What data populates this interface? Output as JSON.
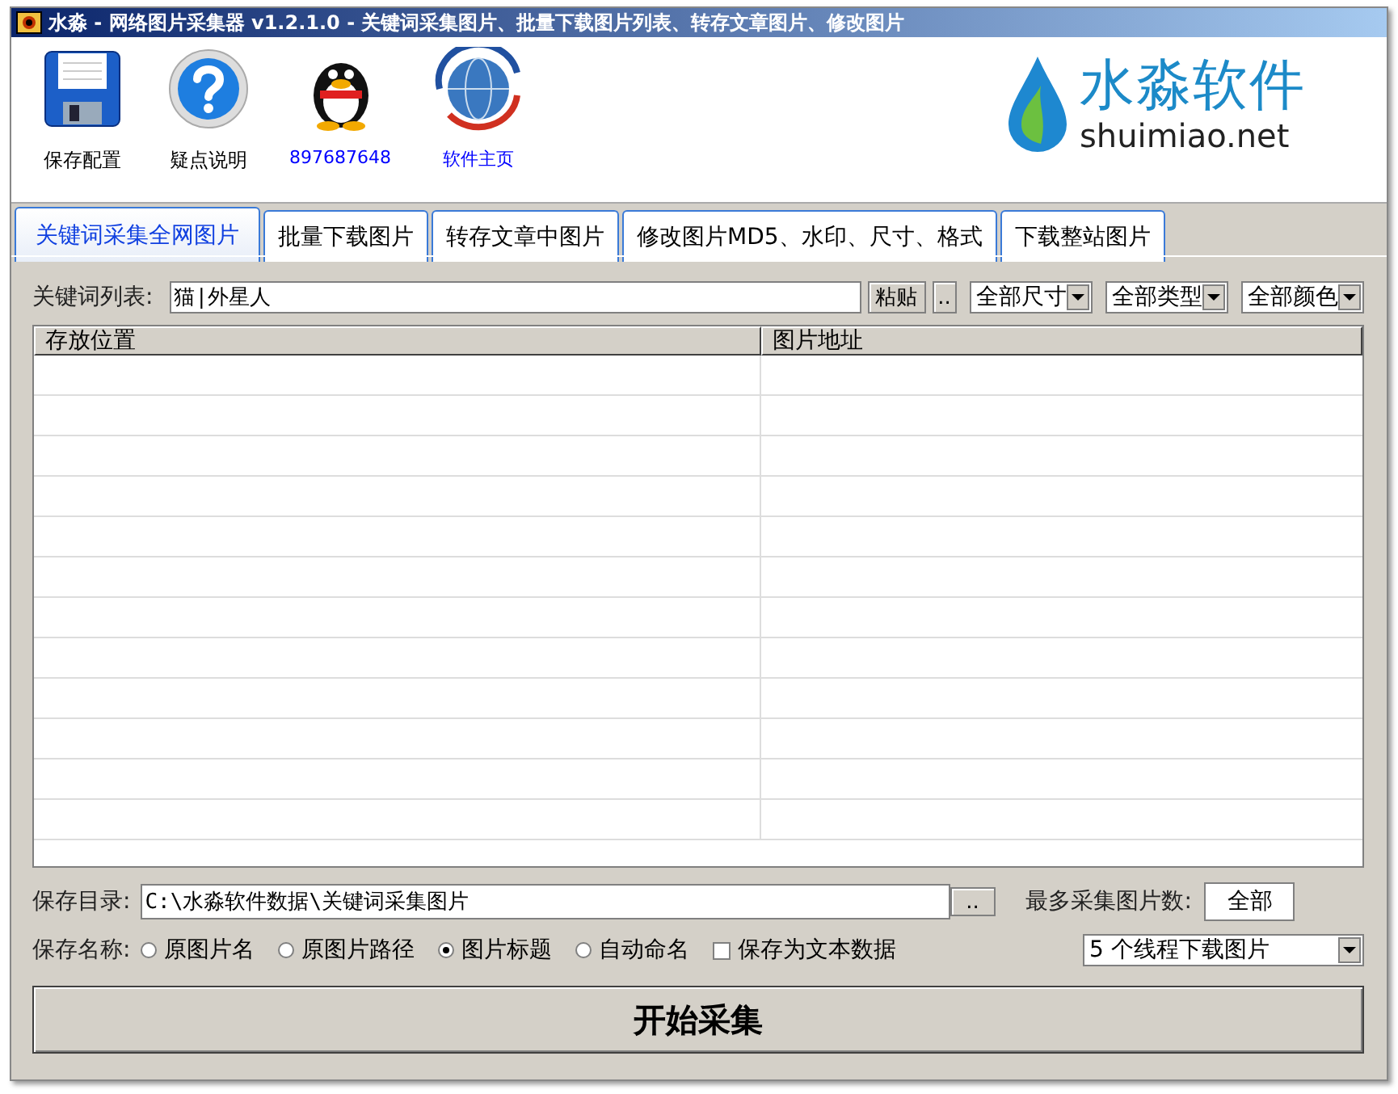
{
  "window": {
    "title": "水淼 - 网络图片采集器 v1.2.1.0 - 关键词采集图片、批量下载图片列表、转存文章图片、修改图片"
  },
  "toolbar": [
    {
      "kind": "save",
      "label": "保存配置",
      "link": false
    },
    {
      "kind": "help",
      "label": "疑点说明",
      "link": false
    },
    {
      "kind": "qq",
      "label": "897687648",
      "link": true
    },
    {
      "kind": "web",
      "label": "软件主页",
      "link": true
    }
  ],
  "logo": {
    "name": "水淼软件",
    "domain": "shuimiao.net"
  },
  "tabs": [
    {
      "label": "关键词采集全网图片",
      "selected": true
    },
    {
      "label": "批量下载图片",
      "selected": false
    },
    {
      "label": "转存文章中图片",
      "selected": false
    },
    {
      "label": "修改图片MD5、水印、尺寸、格式",
      "selected": false
    },
    {
      "label": "下载整站图片",
      "selected": false
    }
  ],
  "keywords": {
    "label": "关键词列表:",
    "value": "猫|外星人",
    "paste_button": "粘贴",
    "browse_button": ".."
  },
  "filters": [
    "全部尺寸",
    "全部类型",
    "全部颜色"
  ],
  "table": {
    "columns": [
      "存放位置",
      "图片地址"
    ]
  },
  "save_dir": {
    "label": "保存目录:",
    "value": "C:\\水淼软件数据\\关键词采集图片",
    "browse_button": ".."
  },
  "max_count": {
    "label": "最多采集图片数:",
    "value": "全部"
  },
  "save_name": {
    "label": "保存名称:",
    "options": [
      {
        "label": "原图片名",
        "selected": false
      },
      {
        "label": "原图片路径",
        "selected": false
      },
      {
        "label": "图片标题",
        "selected": true
      },
      {
        "label": "自动命名",
        "selected": false
      }
    ],
    "save_text": {
      "label": "保存为文本数据",
      "checked": false
    }
  },
  "threads": "5 个线程下载图片",
  "start_button": "开始采集"
}
